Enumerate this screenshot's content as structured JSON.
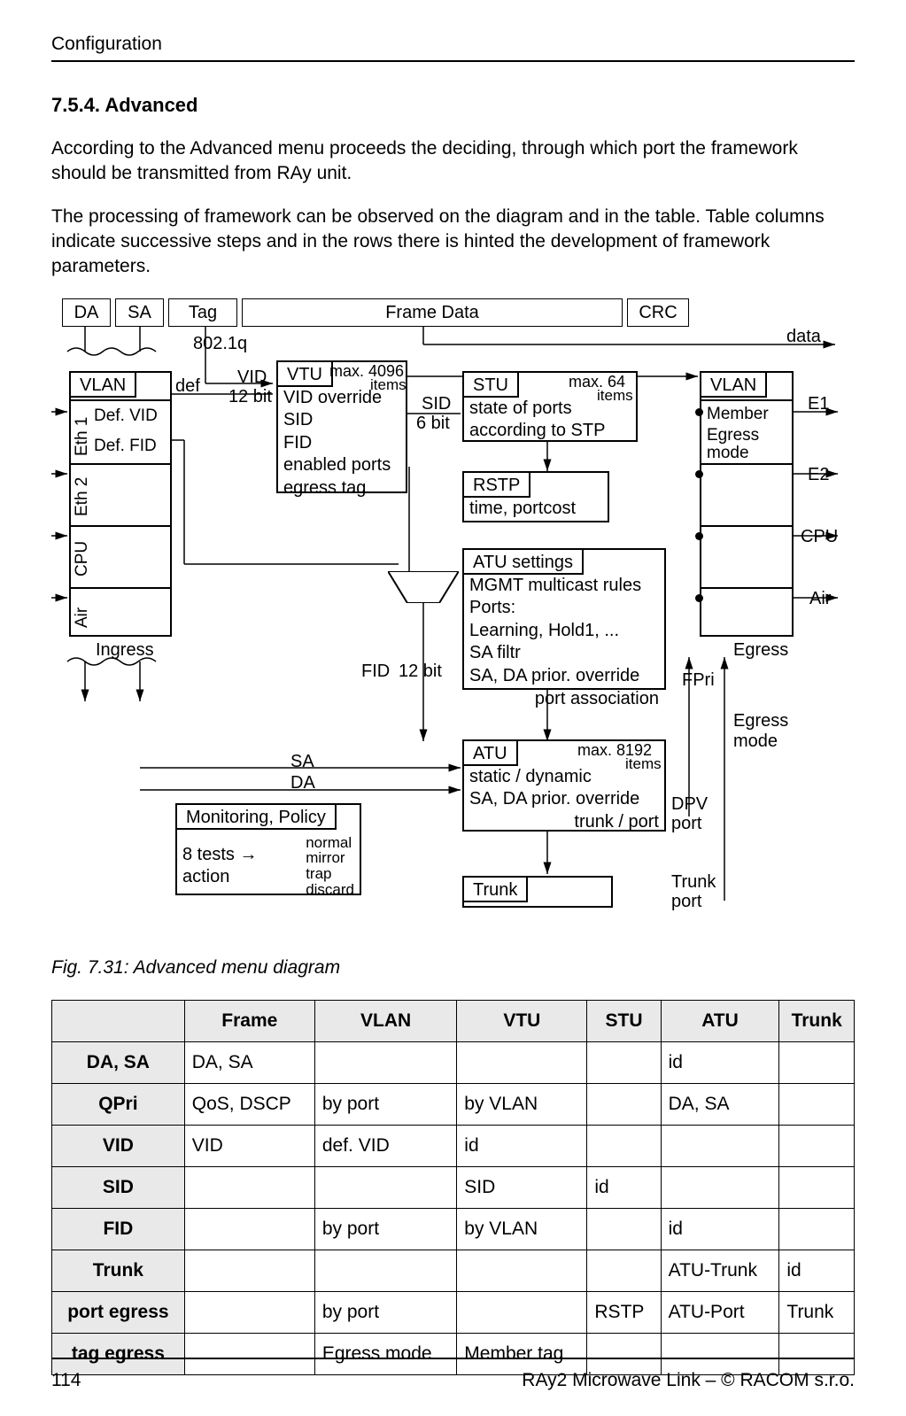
{
  "header": {
    "section": "Configuration"
  },
  "section": {
    "number_title": "7.5.4. Advanced"
  },
  "paragraphs": {
    "p1": "According to the Advanced menu proceeds the deciding, through which port the framework should be transmitted from RAy unit.",
    "p2": "The processing of framework can be observed on the diagram and in the table. Table columns indicate successive steps and in the rows there is hinted the development of framework parameters."
  },
  "diagram": {
    "packet": {
      "da": "DA",
      "sa": "SA",
      "tag": "Tag",
      "frame_data": "Frame Data",
      "crc": "CRC"
    },
    "labels": {
      "q8021": "802.1q",
      "data": "data",
      "vid": "VID",
      "vid_bits": "12 bit",
      "def": "def",
      "sid": "SID",
      "sid_bits": "6 bit",
      "fid": "FID",
      "fid_bits": "12 bit",
      "ingress": "Ingress",
      "egress": "Egress",
      "sa": "SA",
      "da": "DA",
      "fpri": "FPri",
      "egress_mode": "Egress\nmode",
      "dpv": "DPV",
      "dpv_port": "port",
      "trunk_port1": "Trunk",
      "trunk_port2": "port",
      "e1": "E1",
      "e2": "E2",
      "cpu_out": "CPU",
      "air_out": "Air"
    },
    "vlan_left": {
      "title": "VLAN",
      "rows": [
        "Eth 1",
        "Eth 2",
        "CPU",
        "Air"
      ],
      "eth1": {
        "l1": "Def. VID",
        "l2": "Def. FID"
      }
    },
    "vtu": {
      "title": "VTU",
      "max": "max. 4096",
      "items": "items",
      "lines": [
        "VID override",
        "SID",
        "FID",
        "enabled ports",
        "egress tag"
      ]
    },
    "stu": {
      "title": "STU",
      "max": "max. 64",
      "items": "items",
      "l1": "state of ports",
      "l2": "according to STP"
    },
    "rstp": {
      "title": "RSTP",
      "l1": "time, portcost"
    },
    "atu_settings": {
      "title": "ATU settings",
      "l1": "MGMT multicast rules",
      "l2": "Ports:",
      "l3": "Learning, Hold1, ...",
      "l4": "SA filtr",
      "l5": "SA, DA prior. override",
      "l6": "port association"
    },
    "atu": {
      "title": "ATU",
      "max": "max. 8192",
      "items": "items",
      "l1": "static / dynamic",
      "l2": "SA, DA prior. override",
      "l3": "trunk / port"
    },
    "monitoring": {
      "title": "Monitoring, Policy",
      "l1": "8 tests → action",
      "r1": "normal",
      "r2": "mirror",
      "r3": "trap",
      "r4": "discard"
    },
    "trunk": {
      "title": "Trunk"
    },
    "vlan_right": {
      "title": "VLAN",
      "l1": "Member",
      "l2": "Egress",
      "l3": "mode"
    }
  },
  "fig_caption": "Fig. 7.31: Advanced menu diagram",
  "table": {
    "headers": [
      "",
      "Frame",
      "VLAN",
      "VTU",
      "STU",
      "ATU",
      "Trunk"
    ],
    "rows": [
      {
        "head": "DA, SA",
        "cells": [
          "DA, SA",
          "",
          "",
          "",
          "id",
          ""
        ]
      },
      {
        "head": "QPri",
        "cells": [
          "QoS, DSCP",
          "by port",
          "by VLAN",
          "",
          "DA, SA",
          ""
        ]
      },
      {
        "head": "VID",
        "cells": [
          "VID",
          "def. VID",
          "id",
          "",
          "",
          ""
        ]
      },
      {
        "head": "SID",
        "cells": [
          "",
          "",
          "SID",
          "id",
          "",
          ""
        ]
      },
      {
        "head": "FID",
        "cells": [
          "",
          "by port",
          "by VLAN",
          "",
          "id",
          ""
        ]
      },
      {
        "head": "Trunk",
        "cells": [
          "",
          "",
          "",
          "",
          "ATU-Trunk",
          "id"
        ]
      },
      {
        "head": "port egress",
        "cells": [
          "",
          "by port",
          "",
          "RSTP",
          "ATU-Port",
          "Trunk"
        ]
      },
      {
        "head": "tag egress",
        "cells": [
          "",
          "Egress mode",
          "Member tag",
          "",
          "",
          ""
        ]
      }
    ]
  },
  "footer": {
    "page": "114",
    "right": "RAy2 Microwave Link – © RACOM s.r.o."
  }
}
